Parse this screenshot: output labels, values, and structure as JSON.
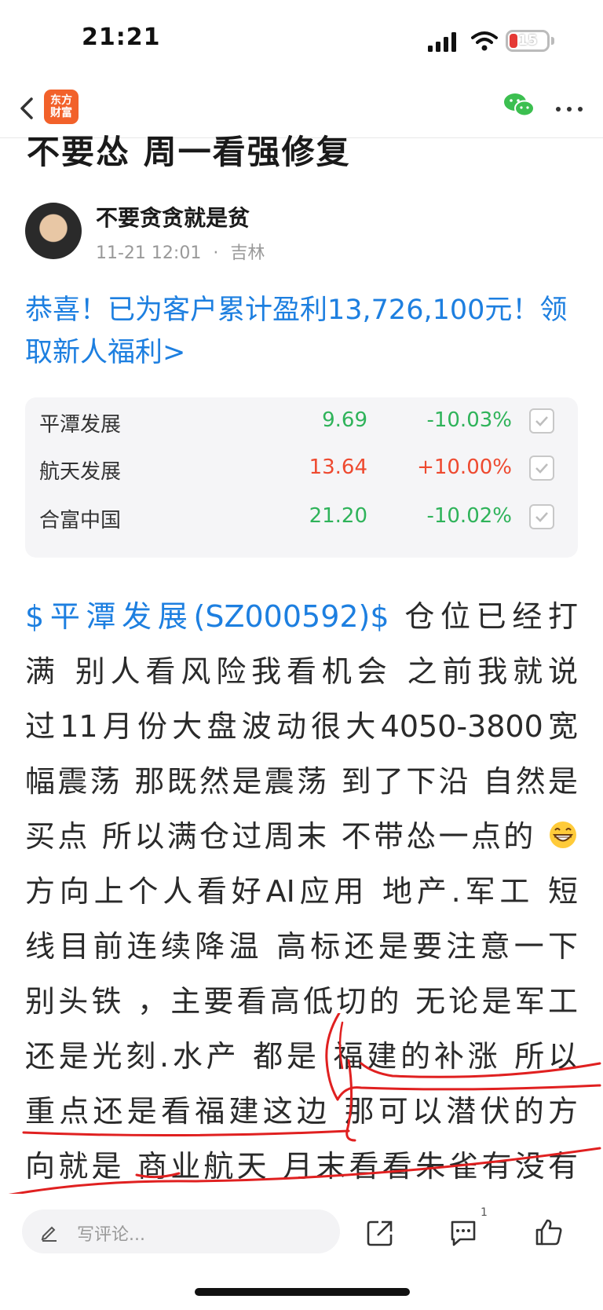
{
  "status_bar": {
    "time": "21:21",
    "battery": "15",
    "icons": [
      "cellular-signal-icon",
      "wifi-icon",
      "low-battery-icon"
    ]
  },
  "nav": {
    "logo_line1": "东方",
    "logo_line2": "财富",
    "icons": [
      "back-icon",
      "wechat-icon",
      "more-icon"
    ],
    "brand_color": "#f2612a"
  },
  "article": {
    "title": "不要怂 周一看强修复",
    "author": "不要贪贪就是贫",
    "date": "11-21 12:01",
    "separator": "·",
    "location": "吉林"
  },
  "promo": {
    "text": "恭喜！已为客户累计盈利13,726,100元！领取新人福利>",
    "color": "#1d7fe0"
  },
  "stocks": [
    {
      "name": "平潭发展",
      "price": "9.69",
      "change": "-10.03%",
      "trend": "down"
    },
    {
      "name": "航天发展",
      "price": "13.64",
      "change": "+10.00%",
      "trend": "up"
    },
    {
      "name": "合富中国",
      "price": "21.20",
      "change": "-10.02%",
      "trend": "down"
    }
  ],
  "colors": {
    "up": "#ee4a30",
    "down": "#2fb35a",
    "link": "#1d7fe0",
    "annotation": "#e02020"
  },
  "body": {
    "stock_tag": "$平潭发展(SZ000592)$",
    "line1_rest": "仓位已经打",
    "lines": [
      "满  别人看风险我看机会  之前我就说",
      "过11月份大盘波动很大4050-3800宽",
      "幅震荡 那既然是震荡 到了下沿 自然是",
      "买点 所以满仓过周末 不带怂一点的",
      "方向上个人看好AI应用 地产.军工  短",
      "线目前连续降温 高标还是要注意一下",
      "别头铁 ，主要看高低切的 无论是军工",
      "还是光刻.水产  都是 福建的补涨 所以",
      "重点还是看福建这边  那可以潜伏的方",
      "向就是 商业航天 月末看看朱雀有没有"
    ]
  },
  "bottom_bar": {
    "comment_placeholder": "写评论...",
    "comment_count": "1",
    "icons": [
      "pencil-icon",
      "share-icon",
      "comment-icon",
      "like-icon"
    ]
  }
}
